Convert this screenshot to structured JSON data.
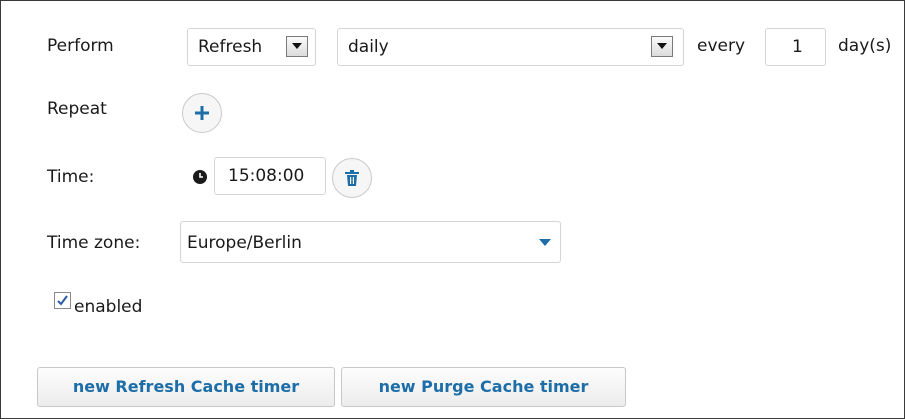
{
  "perform": {
    "label": "Perform",
    "action_value": "Refresh",
    "frequency_value": "daily",
    "every_label": "every",
    "interval_value": "1",
    "unit_label": "day(s)"
  },
  "repeat": {
    "label": "Repeat"
  },
  "time": {
    "label": "Time:",
    "value": "15:08:00"
  },
  "timezone": {
    "label": "Time zone:",
    "value": "Europe/Berlin"
  },
  "enabled": {
    "label": "enabled",
    "checked": true
  },
  "buttons": {
    "new_refresh": "new Refresh Cache timer",
    "new_purge": "new Purge Cache timer"
  },
  "colors": {
    "accent": "#1d6ea8",
    "border": "#3a3a3a"
  }
}
